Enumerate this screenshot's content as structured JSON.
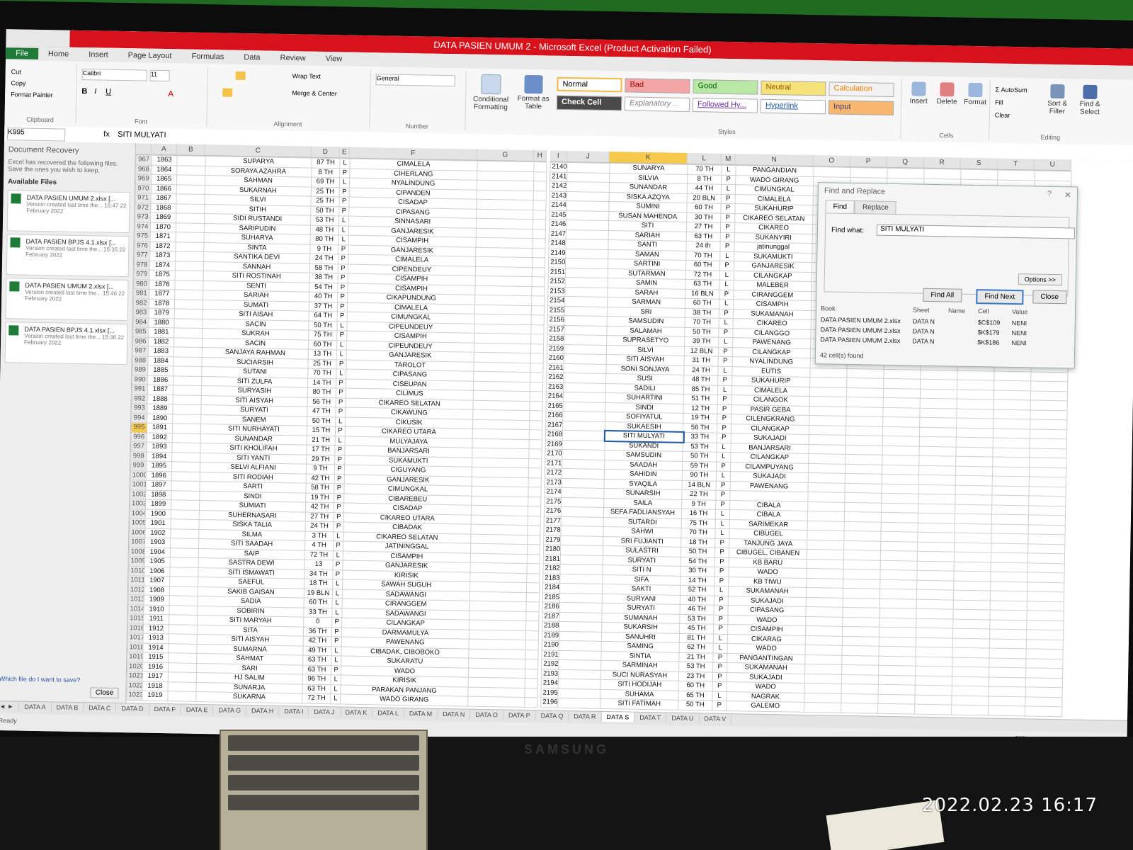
{
  "photo": {
    "timestamp": "2022.02.23 16:17",
    "monitor_brand": "SAMSUNG"
  },
  "excel": {
    "title": "DATA PASIEN UMUM 2 - Microsoft Excel (Product Activation Failed)",
    "tabs": [
      "File",
      "Home",
      "Insert",
      "Page Layout",
      "Formulas",
      "Data",
      "Review",
      "View"
    ],
    "ribbon": {
      "clipboard": {
        "cut": "Cut",
        "copy": "Copy",
        "format_painter": "Format Painter",
        "label": "Clipboard"
      },
      "font": {
        "name": "Calibri",
        "size": "11",
        "label": "Font"
      },
      "alignment": {
        "wrap": "Wrap Text",
        "merge": "Merge & Center",
        "label": "Alignment"
      },
      "number": {
        "format": "General",
        "label": "Number"
      },
      "conditional": "Conditional Formatting",
      "format_table": "Format as Table",
      "styles": {
        "label": "Styles",
        "normal": "Normal",
        "bad": "Bad",
        "good": "Good",
        "neutral": "Neutral",
        "calculation": "Calculation",
        "check_cell": "Check Cell",
        "explanatory": "Explanatory ...",
        "followed": "Followed Hy...",
        "hyperlink": "Hyperlink",
        "input": "Input"
      },
      "cells": {
        "insert": "Insert",
        "delete": "Delete",
        "format": "Format",
        "label": "Cells"
      },
      "editing": {
        "autosum": "AutoSum",
        "fill": "Fill",
        "clear": "Clear",
        "sort": "Sort & Filter",
        "find": "Find & Select",
        "label": "Editing"
      }
    },
    "formula_bar": {
      "name_box": "K995",
      "fx": "fx",
      "value": "SITI MULYATI"
    },
    "recovery_pane": {
      "title": "Document Recovery",
      "info": "Excel has recovered the following files. Save the ones you wish to keep.",
      "available": "Available Files",
      "files": [
        {
          "name": "DATA PASIEN UMUM 2.xlsx [...",
          "desc": "Version created last time the... 16:47 22 February 2022"
        },
        {
          "name": "DATA PASIEN BPJS 4.1.xlsx [...",
          "desc": "Version created last time the... 15:35 22 February 2022"
        },
        {
          "name": "DATA PASIEN UMUM 2.xlsx [...",
          "desc": "Version created last time the... 15:46 22 February 2022"
        },
        {
          "name": "DATA PASIEN BPJS 4.1.xlsx [...",
          "desc": "Version created last time the... 15:36 22 February 2022"
        }
      ],
      "question": "Which file do I want to save?",
      "close": "Close"
    },
    "left_columns": [
      "A",
      "B",
      "C",
      "D",
      "E",
      "F",
      "G",
      "H"
    ],
    "right_columns": [
      "I",
      "J",
      "K",
      "L",
      "M",
      "N",
      "O",
      "P",
      "Q",
      "R",
      "S",
      "T",
      "U"
    ],
    "left_rows": [
      [
        "967",
        "1863",
        "SUPARYA",
        "87 TH",
        "L",
        "CIMALELA"
      ],
      [
        "968",
        "1864",
        "SORAYA AZAHRA",
        "8 TH",
        "P",
        "CIHERLANG"
      ],
      [
        "969",
        "1865",
        "SAHMAN",
        "69 TH",
        "L",
        "NYALINDUNG"
      ],
      [
        "970",
        "1866",
        "SUKARNAH",
        "25 TH",
        "P",
        "CIPANDEN"
      ],
      [
        "971",
        "1867",
        "SILVI",
        "25 TH",
        "P",
        "CISADAP"
      ],
      [
        "972",
        "1868",
        "SITIH",
        "50 TH",
        "P",
        "CIPASANG"
      ],
      [
        "973",
        "1869",
        "SIDI RUSTANDI",
        "53 TH",
        "L",
        "SINNASARI"
      ],
      [
        "974",
        "1870",
        "SARIPUDIN",
        "48 TH",
        "L",
        "GANJARESIK"
      ],
      [
        "975",
        "1871",
        "SUHARYA",
        "80 TH",
        "L",
        "CISAMPIH"
      ],
      [
        "976",
        "1872",
        "SINTA",
        "9 TH",
        "P",
        "GANJARESIK"
      ],
      [
        "977",
        "1873",
        "SANTIKA DEVI",
        "24 TH",
        "P",
        "CIMALELA"
      ],
      [
        "978",
        "1874",
        "SANNAH",
        "58 TH",
        "P",
        "CIPENDEUY"
      ],
      [
        "979",
        "1875",
        "SITI ROSTINAH",
        "38 TH",
        "P",
        "CISAMPIH"
      ],
      [
        "980",
        "1876",
        "SENTI",
        "54 TH",
        "P",
        "CISAMPIH"
      ],
      [
        "981",
        "1877",
        "SARIAH",
        "40 TH",
        "P",
        "CIKAPUNDUNG"
      ],
      [
        "982",
        "1878",
        "SUMATI",
        "37 TH",
        "P",
        "CIMALELA"
      ],
      [
        "983",
        "1879",
        "SITI AISAH",
        "64 TH",
        "P",
        "CIMUNGKAL"
      ],
      [
        "984",
        "1880",
        "SACIN",
        "50 TH",
        "L",
        "CIPEUNDEUY"
      ],
      [
        "985",
        "1881",
        "SUKRAH",
        "75 TH",
        "P",
        "CISAMPIH"
      ],
      [
        "986",
        "1882",
        "SACIN",
        "60 TH",
        "L",
        "CIPEUNDEUY"
      ],
      [
        "987",
        "1883",
        "SANJAYA RAHMAN",
        "13 TH",
        "L",
        "GANJARESIK"
      ],
      [
        "988",
        "1884",
        "SUCIARSIH",
        "25 TH",
        "P",
        "TAROLOT"
      ],
      [
        "989",
        "1885",
        "SUTANI",
        "70 TH",
        "L",
        "CIPASANG"
      ],
      [
        "990",
        "1886",
        "SITI ZULFA",
        "14 TH",
        "P",
        "CISEUPAN"
      ],
      [
        "991",
        "1887",
        "SURYASIH",
        "80 TH",
        "P",
        "CILIMUS"
      ],
      [
        "992",
        "1888",
        "SITI AISYAH",
        "56 TH",
        "P",
        "CIKAREO SELATAN"
      ],
      [
        "993",
        "1889",
        "SURYATI",
        "47 TH",
        "P",
        "CIKAWUNG"
      ],
      [
        "994",
        "1890",
        "SANEM",
        "50 TH",
        "L",
        "CIKUSIK"
      ],
      [
        "995",
        "1891",
        "SITI NURHAYATI",
        "15 TH",
        "P",
        "CIKAREO UTARA"
      ],
      [
        "996",
        "1892",
        "SUNANDAR",
        "21 TH",
        "L",
        "MULYAJAYA"
      ],
      [
        "997",
        "1893",
        "SITI KHOLIFAH",
        "17 TH",
        "P",
        "BANJARSARI"
      ],
      [
        "998",
        "1894",
        "SITI YANTI",
        "29 TH",
        "P",
        "SUKAMUKTI"
      ],
      [
        "999",
        "1895",
        "SELVI ALFIANI",
        "9 TH",
        "P",
        "CIGUYANG"
      ],
      [
        "1000",
        "1896",
        "SITI RODIAH",
        "42 TH",
        "P",
        "GANJARESIK"
      ],
      [
        "1001",
        "1897",
        "SARTI",
        "58 TH",
        "P",
        "CIMUNGKAL"
      ],
      [
        "1002",
        "1898",
        "SINDI",
        "19 TH",
        "P",
        "CIBAREBEU"
      ],
      [
        "1003",
        "1899",
        "SUMIATI",
        "42 TH",
        "P",
        "CISADAP"
      ],
      [
        "1004",
        "1900",
        "SUHERNASARI",
        "27 TH",
        "P",
        "CIKAREO UTARA"
      ],
      [
        "1005",
        "1901",
        "SISKA TALIA",
        "24 TH",
        "P",
        "CIBADAK"
      ],
      [
        "1006",
        "1902",
        "SILMA",
        "3 TH",
        "L",
        "CIKAREO SELATAN"
      ],
      [
        "1007",
        "1903",
        "SITI SAADAH",
        "4 TH",
        "P",
        "JATININGGAL"
      ],
      [
        "1008",
        "1904",
        "SAIP",
        "72 TH",
        "L",
        "CISAMPIH"
      ],
      [
        "1009",
        "1905",
        "SASTRA DEWI",
        "13",
        "P",
        "GANJARESIK"
      ],
      [
        "1010",
        "1906",
        "SITI ISMAWATI",
        "34 TH",
        "P",
        "KIRISIK"
      ],
      [
        "1011",
        "1907",
        "SAEFUL",
        "18 TH",
        "L",
        "SAWAH SUGUH"
      ],
      [
        "1012",
        "1908",
        "SAKIB GAISAN",
        "19 BLN",
        "L",
        "SADAWANGI"
      ],
      [
        "1013",
        "1909",
        "SADIA",
        "60 TH",
        "L",
        "CIRANGGEM"
      ],
      [
        "1014",
        "1910",
        "SOBIRIN",
        "33 TH",
        "L",
        "SADAWANGI"
      ],
      [
        "1015",
        "1911",
        "SITI MARYAH",
        "0",
        "P",
        "CILANGKAP"
      ],
      [
        "1016",
        "1912",
        "SITA",
        "36 TH",
        "P",
        "DARMAMULYA"
      ],
      [
        "1017",
        "1913",
        "SITI AISYAH",
        "42 TH",
        "P",
        "PAWENANG"
      ],
      [
        "1018",
        "1914",
        "SUMARNA",
        "49 TH",
        "L",
        "CIBADAK, CIBOBOKO"
      ],
      [
        "1019",
        "1915",
        "SAHMAT",
        "63 TH",
        "L",
        "SUKARATU"
      ],
      [
        "1020",
        "1916",
        "SARI",
        "63 TH",
        "P",
        "WADO"
      ],
      [
        "1021",
        "1917",
        "HJ SALIM",
        "96 TH",
        "L",
        "KIRISIK"
      ],
      [
        "1022",
        "1918",
        "SUNARJA",
        "63 TH",
        "L",
        "PARAKAN PANJANG"
      ],
      [
        "1023",
        "1919",
        "SUKARNA",
        "72 TH",
        "L",
        "WADO GIRANG"
      ]
    ],
    "right_rows": [
      [
        "2140",
        "SUNARYA",
        "70 TH",
        "L",
        "PANGANDIAN"
      ],
      [
        "2141",
        "SILVIA",
        "8 TH",
        "P",
        "WADO GIRANG"
      ],
      [
        "2142",
        "SUNANDAR",
        "44 TH",
        "L",
        "CIMUNGKAL"
      ],
      [
        "2143",
        "SISKA AZQYA",
        "20 BLN",
        "P",
        "CIMALELA"
      ],
      [
        "2144",
        "SUMINI",
        "60 TH",
        "P",
        "SUKAHURIP"
      ],
      [
        "2145",
        "SUSAN MAHENDA",
        "30 TH",
        "P",
        "CIKAREO SELATAN"
      ],
      [
        "2146",
        "SITI",
        "27 TH",
        "P",
        "CIKAREO"
      ],
      [
        "2147",
        "SARIAH",
        "63 TH",
        "P",
        "SUKANYIRI"
      ],
      [
        "2148",
        "SANTI",
        "24 th",
        "P",
        "jatinunggal"
      ],
      [
        "2149",
        "SAMAN",
        "70 TH",
        "L",
        "SUKAMUKTI"
      ],
      [
        "2150",
        "SARTINI",
        "60 TH",
        "P",
        "GANJARESIK"
      ],
      [
        "2151",
        "SUTARMAN",
        "72 TH",
        "L",
        "CILANGKAP"
      ],
      [
        "2152",
        "SAMIN",
        "63 TH",
        "L",
        "MALEBER"
      ],
      [
        "2153",
        "SARAH",
        "16 BLN",
        "P",
        "CIRANGGEM"
      ],
      [
        "2154",
        "SARMAN",
        "60 TH",
        "L",
        "CISAMPIH"
      ],
      [
        "2155",
        "SRI",
        "38 TH",
        "P",
        "SUKAMANAH"
      ],
      [
        "2156",
        "SAMSUDIN",
        "70 TH",
        "L",
        "CIKAREO"
      ],
      [
        "2157",
        "SALAMAH",
        "50 TH",
        "P",
        "CILANGGO"
      ],
      [
        "2158",
        "SUPRASETYO",
        "39 TH",
        "L",
        "PAWENANG"
      ],
      [
        "2159",
        "SILVI",
        "12 BLN",
        "P",
        "CILANGKAP"
      ],
      [
        "2160",
        "SITI AISYAH",
        "31 TH",
        "P",
        "NYALINDUNG"
      ],
      [
        "2161",
        "SONI SONJAYA",
        "24 TH",
        "L",
        "EUTIS"
      ],
      [
        "2162",
        "SUSI",
        "48 TH",
        "P",
        "SUKAHURIP"
      ],
      [
        "2163",
        "SADILI",
        "85 TH",
        "L",
        "CIMALELA"
      ],
      [
        "2164",
        "SUHARTINI",
        "51 TH",
        "P",
        "CILANGOK"
      ],
      [
        "2165",
        "SINDI",
        "12 TH",
        "P",
        "PASIR GEBA"
      ],
      [
        "2166",
        "SOFIYATUL",
        "19 TH",
        "P",
        "CILENGKRANG"
      ],
      [
        "2167",
        "SUKAESIH",
        "56 TH",
        "P",
        "CILANGKAP"
      ],
      [
        "2168",
        "SITI MULYATI",
        "33 TH",
        "P",
        "SUKAJADI"
      ],
      [
        "2169",
        "SUKANDI",
        "53 TH",
        "L",
        "BANJARSARI"
      ],
      [
        "2170",
        "SAMSUDIN",
        "50 TH",
        "L",
        "CILANGKAP"
      ],
      [
        "2171",
        "SAADAH",
        "59 TH",
        "P",
        "CILAMPUYANG"
      ],
      [
        "2172",
        "SAHIDIN",
        "90 TH",
        "L",
        "SUKAJADI"
      ],
      [
        "2173",
        "SYAQILA",
        "14 BLN",
        "P",
        "PAWENANG"
      ],
      [
        "2174",
        "SUNARSIH",
        "22 TH",
        "P",
        ""
      ],
      [
        "2175",
        "SAILA",
        "9 TH",
        "P",
        "CIBALA"
      ],
      [
        "2176",
        "SEFA FADLIANSYAH",
        "16 TH",
        "L",
        "CIBALA"
      ],
      [
        "2177",
        "SUTARDI",
        "75 TH",
        "L",
        "SARIMEKAR"
      ],
      [
        "2178",
        "SAHWI",
        "70 TH",
        "L",
        "CIBUGEL"
      ],
      [
        "2179",
        "SRI FUJIANTI",
        "18 TH",
        "P",
        "TANJUNG JAYA"
      ],
      [
        "2180",
        "SULASTRI",
        "50 TH",
        "P",
        "CIBUGEL, CIBANEN"
      ],
      [
        "2181",
        "SURYATI",
        "54 TH",
        "P",
        "KB BARU"
      ],
      [
        "2182",
        "SITI N",
        "30 TH",
        "P",
        "WADO"
      ],
      [
        "2183",
        "SIFA",
        "14 TH",
        "P",
        "KB TIWU"
      ],
      [
        "2184",
        "SAKTI",
        "52 TH",
        "L",
        "SUKAMANAH"
      ],
      [
        "2185",
        "SURYANI",
        "40 TH",
        "P",
        "SUKAJADI"
      ],
      [
        "2186",
        "SURYATI",
        "46 TH",
        "P",
        "CIPASANG"
      ],
      [
        "2187",
        "SUMANAH",
        "53 TH",
        "P",
        "WADO"
      ],
      [
        "2188",
        "SUKARSIH",
        "45 TH",
        "P",
        "CISAMPIH"
      ],
      [
        "2189",
        "SANUHRI",
        "81 TH",
        "L",
        "CIKARAG"
      ],
      [
        "2190",
        "SAMING",
        "62 TH",
        "L",
        "WADO"
      ],
      [
        "2191",
        "SINTIA",
        "21 TH",
        "P",
        "PANGANTINGAN"
      ],
      [
        "2192",
        "SARMINAH",
        "53 TH",
        "P",
        "SUKAMANAH"
      ],
      [
        "2193",
        "SUCI NURASYAH",
        "23 TH",
        "P",
        "SUKAJADI"
      ],
      [
        "2194",
        "SITI HODIJAH",
        "60 TH",
        "P",
        "WADO"
      ],
      [
        "2195",
        "SUHAMA",
        "65 TH",
        "L",
        "NAGRAK"
      ],
      [
        "2196",
        "SITI FATIMAH",
        "50 TH",
        "P",
        "GALEMO"
      ]
    ],
    "find_dialog": {
      "title": "Find and Replace",
      "help": "?",
      "tab_find": "Find",
      "tab_replace": "Replace",
      "find_label": "Find what:",
      "find_value": "SITI MULYATI",
      "options": "Options >>",
      "find_all": "Find All",
      "find_next": "Find Next",
      "close": "Close",
      "headers": [
        "Book",
        "Sheet",
        "Name",
        "Cell",
        "Value"
      ],
      "results": [
        [
          "DATA PASIEN UMUM 2.xlsx",
          "DATA N",
          "",
          "$C$109",
          "NENI"
        ],
        [
          "DATA PASIEN UMUM 2.xlsx",
          "DATA N",
          "",
          "$K$179",
          "NENI"
        ],
        [
          "DATA PASIEN UMUM 2.xlsx",
          "DATA N",
          "",
          "$K$186",
          "NENI"
        ]
      ],
      "status": "42 cell(s) found"
    },
    "sheet_tabs": [
      "DATA A",
      "DATA B",
      "DATA C",
      "DATA D",
      "DATA F",
      "DATA E",
      "DATA G",
      "DATA H",
      "DATA I",
      "DATA J",
      "DATA K",
      "DATA L",
      "DATA M",
      "DATA N",
      "DATA O",
      "DATA P",
      "DATA Q",
      "DATA R",
      "DATA S",
      "DATA T",
      "DATA U",
      "DATA V"
    ],
    "active_sheet": "DATA S",
    "status": {
      "ready": "Ready",
      "zoom": "80%"
    }
  }
}
